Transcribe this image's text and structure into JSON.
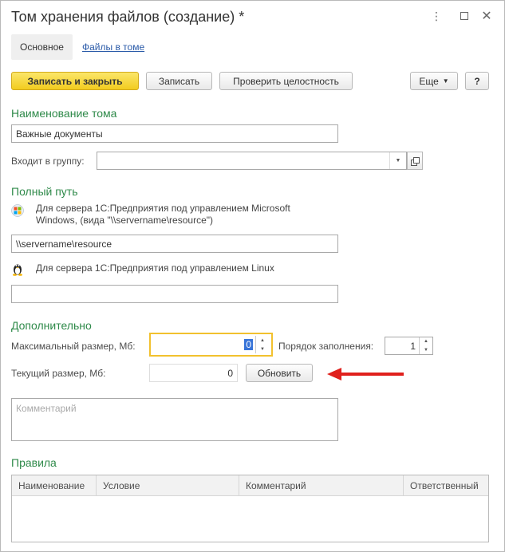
{
  "window": {
    "title": "Том хранения файлов (создание) *"
  },
  "tabs": {
    "main": "Основное",
    "files": "Файлы в томе"
  },
  "toolbar": {
    "save_close": "Записать и закрыть",
    "save": "Записать",
    "check": "Проверить целостность",
    "more": "Еще",
    "help": "?"
  },
  "naming": {
    "section": "Наименование тома",
    "name_value": "Важные документы",
    "group_label": "Входит в группу:",
    "group_value": ""
  },
  "path": {
    "section": "Полный путь",
    "windows_note": "Для сервера 1С:Предприятия под управлением Microsoft Windows, (вида \"\\\\servername\\resource\")",
    "windows_value": "\\\\servername\\resource",
    "linux_note": "Для сервера 1С:Предприятия под управлением Linux",
    "linux_value": ""
  },
  "extra": {
    "section": "Дополнительно",
    "max_size_label": "Максимальный размер, Мб:",
    "max_size_value": "0",
    "order_label": "Порядок заполнения:",
    "order_value": "1",
    "current_size_label": "Текущий размер, Мб:",
    "current_size_value": "0",
    "refresh_button": "Обновить",
    "comment_placeholder": "Комментарий"
  },
  "rules": {
    "section": "Правила",
    "columns": [
      "Наименование",
      "Условие",
      "Комментарий",
      "Ответственный"
    ]
  },
  "colors": {
    "accent_green": "#2f8a4a",
    "primary_yellow": "#f5d43a",
    "arrow_red": "#e0201c",
    "link_blue": "#2a5aa8"
  }
}
